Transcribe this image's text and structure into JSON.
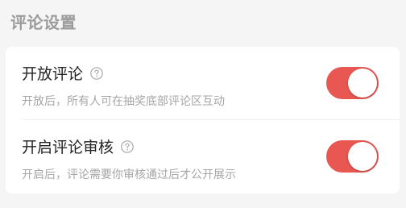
{
  "section": {
    "title": "评论设置"
  },
  "settings": [
    {
      "label": "开放评论",
      "description": "开放后，所有人可在抽奖底部评论区互动",
      "help_icon": "question-circle-icon",
      "enabled": true
    },
    {
      "label": "开启评论审核",
      "description": "开启后，评论需要你审核通过后才公开展示",
      "help_icon": "question-circle-icon",
      "enabled": true
    }
  ],
  "colors": {
    "toggle_on": "#e95752",
    "page_background": "#f5f5f5",
    "card_background": "#ffffff"
  }
}
